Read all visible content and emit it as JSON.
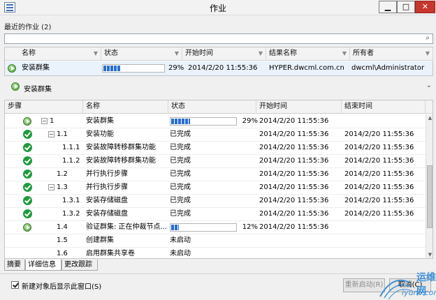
{
  "window": {
    "title": "作业"
  },
  "recent_jobs": {
    "label": "最近的作业 (2)",
    "search_placeholder": "",
    "columns": [
      "名称",
      "状态",
      "开始时间",
      "结果名称",
      "所有者"
    ],
    "rows": [
      {
        "name": "安装群集",
        "percent": "29%",
        "progress": 0.29,
        "start": "2014/2/20 11:55:36",
        "result": "HYPER.dwcml.com.cn",
        "owner": "dwcml\\Administrator"
      }
    ]
  },
  "detail": {
    "title": "安装群集",
    "columns": [
      "步骤",
      "名称",
      "状态",
      "开始时间",
      "结束时间"
    ],
    "rows": [
      {
        "icon": "play",
        "step": "1",
        "name": "安装群集",
        "status": "",
        "bar": true,
        "progress": 0.29,
        "percent": "29%",
        "start": "2014/2/20 11:55:36",
        "end": ""
      },
      {
        "icon": "check",
        "step": "1.1",
        "name": "安装功能",
        "status": "已完成",
        "bar": false,
        "start": "2014/2/20 11:55:36",
        "end": "2014/2/20 11:55:36"
      },
      {
        "icon": "check",
        "step": "1.1.1",
        "name": "安装故障转移群集功能",
        "status": "已完成",
        "bar": false,
        "start": "2014/2/20 11:55:36",
        "end": "2014/2/20 11:55:36"
      },
      {
        "icon": "check",
        "step": "1.1.2",
        "name": "安装故障转移群集功能",
        "status": "已完成",
        "bar": false,
        "start": "2014/2/20 11:55:36",
        "end": "2014/2/20 11:55:36"
      },
      {
        "icon": "check",
        "step": "1.2",
        "name": "并行执行步骤",
        "status": "已完成",
        "bar": false,
        "start": "2014/2/20 11:55:36",
        "end": "2014/2/20 11:55:36"
      },
      {
        "icon": "check",
        "step": "1.3",
        "name": "并行执行步骤",
        "status": "已完成",
        "bar": false,
        "start": "2014/2/20 11:55:36",
        "end": "2014/2/20 11:55:36"
      },
      {
        "icon": "check",
        "step": "1.3.1",
        "name": "安装存储磁盘",
        "status": "已完成",
        "bar": false,
        "start": "2014/2/20 11:55:36",
        "end": "2014/2/20 11:55:36"
      },
      {
        "icon": "check",
        "step": "1.3.2",
        "name": "安装存储磁盘",
        "status": "已完成",
        "bar": false,
        "start": "2014/2/20 11:55:36",
        "end": "2014/2/20 11:55:36"
      },
      {
        "icon": "play",
        "step": "1.4",
        "name": "验证群集: 正在仲裁节点...",
        "status": "",
        "bar": true,
        "progress": 0.12,
        "percent": "12%",
        "start": "2014/2/20 11:55:36",
        "end": ""
      },
      {
        "icon": "",
        "step": "1.5",
        "name": "创建群集",
        "status": "未启动",
        "bar": false,
        "start": "",
        "end": ""
      },
      {
        "icon": "",
        "step": "1.6",
        "name": "启用群集共享卷",
        "status": "未启动",
        "bar": false,
        "start": "",
        "end": ""
      }
    ]
  },
  "tabs": [
    "摘要",
    "详细信息",
    "更改跟踪"
  ],
  "footer": {
    "checkbox_label": "新建对象后显示此窗口(S)",
    "restart_label": "重新启动(R)",
    "cancel_label": "取消(C)"
  },
  "watermark": {
    "line1": "运维网",
    "line2": "iyunv.com"
  }
}
